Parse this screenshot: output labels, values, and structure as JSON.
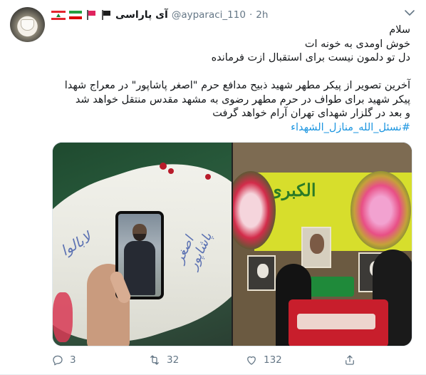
{
  "tweet": {
    "display_name": "آی پاراسی",
    "handle": "@ayparaci_110",
    "dot": "·",
    "time": "2h",
    "lines": [
      "سلام",
      "خوش اومدی به خونه ات",
      "دل تو دلمون نیست برای استقبال ازت فرمانده",
      "",
      "آخرین تصویر از پیکر مطهر شهید ذبیح مدافع حرم \"اصغر پاشاپور\" در معراج شهدا",
      "پیکر شهید برای طواف در حرم مطهر رضوی به مشهد مقدس منتقل خواهد شد",
      "و بعد در گلزار شهدای تهران آرام خواهد گرفت"
    ],
    "hashtag": "#نسئل_الله_منازل_الشهداء",
    "icons": {
      "header": [
        "lebanon-flag-icon",
        "iran-flag-icon",
        "red-flag-icon",
        "black-flag-icon"
      ],
      "caret": "chevron-down-icon"
    },
    "photos": {
      "left_script": [
        "لابالوا",
        "اصغر پاشاپور"
      ],
      "right_banner": [
        "الكبرى",
        "ص"
      ]
    },
    "actions": {
      "reply_count": "3",
      "retweet_count": "32",
      "like_count": "132"
    },
    "colors": {
      "link": "#1b95e0",
      "muted": "#657786",
      "text": "#14171a"
    }
  }
}
